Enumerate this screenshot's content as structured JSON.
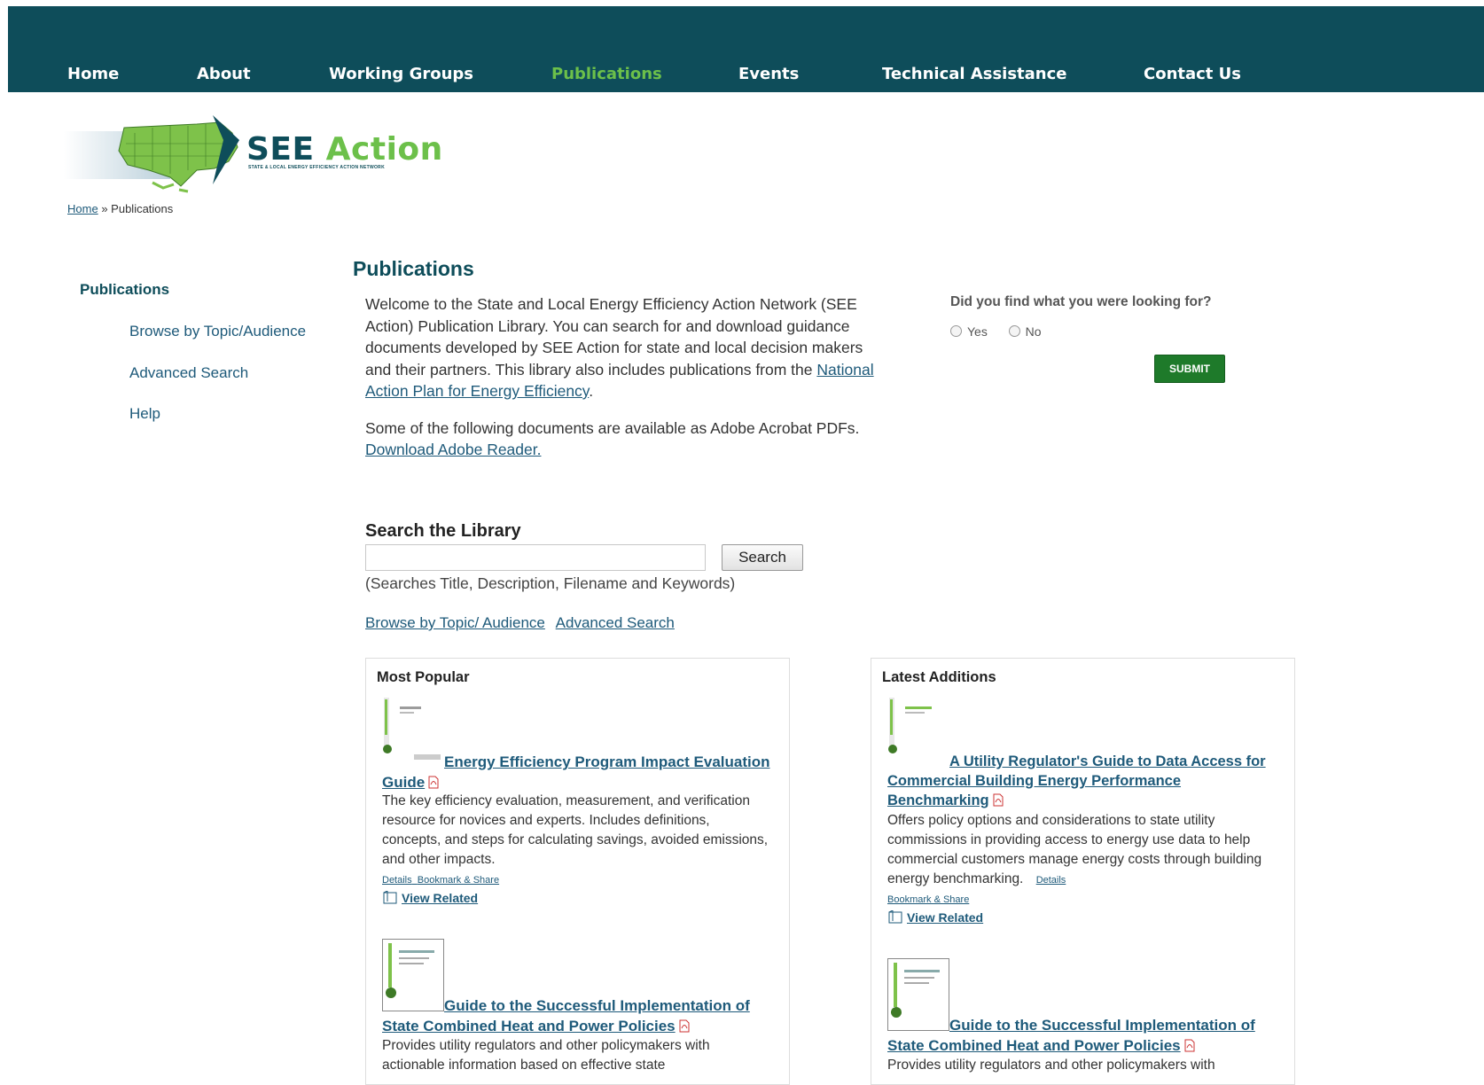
{
  "nav": {
    "items": [
      {
        "label": "Home"
      },
      {
        "label": "About"
      },
      {
        "label": "Working Groups"
      },
      {
        "label": "Publications"
      },
      {
        "label": "Events"
      },
      {
        "label": "Technical Assistance"
      },
      {
        "label": "Contact Us"
      }
    ],
    "active": "Publications",
    "colors": {
      "bar": "#0e4d5a",
      "active": "#6cc04a",
      "text": "#ffffff"
    }
  },
  "logo": {
    "see": "SEE",
    "action": "Action",
    "tagline": "STATE & LOCAL ENERGY EFFICIENCY ACTION NETWORK"
  },
  "breadcrumb": {
    "home": "Home",
    "sep": "»",
    "current": "Publications"
  },
  "sidebar": {
    "title": "Publications",
    "links": [
      {
        "label": "Browse by Topic/Audience"
      },
      {
        "label": "Advanced Search"
      },
      {
        "label": "Help"
      }
    ]
  },
  "main": {
    "title": "Publications",
    "intro_p1_before": "Welcome to the State and Local Energy Efficiency Action Network (SEE Action) Publication Library. You can search for and download guidance documents developed by SEE Action for state and local decision makers and their partners. This library also includes publications from the ",
    "intro_p1_link": "National Action Plan for Energy Efficiency",
    "intro_p1_after": ".",
    "intro_p2_before": "Some of the following documents are available as Adobe Acrobat PDFs. ",
    "intro_p2_link": "Download Adobe Reader."
  },
  "survey": {
    "question": "Did you find what you were looking for?",
    "yes": "Yes",
    "no": "No",
    "submit": "SUBMIT"
  },
  "search": {
    "heading": "Search the Library",
    "value": "",
    "button": "Search",
    "help": "(Searches Title, Description, Filename and Keywords)",
    "link_browse": "Browse by Topic/ Audience",
    "link_advanced": "Advanced Search"
  },
  "most_popular": {
    "title": "Most Popular",
    "items": [
      {
        "title": "Energy Efficiency Program Impact Evaluation Guide",
        "description": "The key efficiency evaluation, measurement, and verification resource for novices and experts. Includes definitions, concepts, and steps for calculating savings, avoided emissions, and other impacts.",
        "details": "Details",
        "bookmark": "Bookmark & Share",
        "view_related": "View Related"
      },
      {
        "title": "Guide to the Successful Implementation of State Combined Heat and Power Policies",
        "description": "Provides utility regulators and other policymakers with actionable information based on effective state"
      }
    ]
  },
  "latest_additions": {
    "title": "Latest Additions",
    "items": [
      {
        "title": "A Utility Regulator's Guide to Data Access for Commercial Building Energy Performance Benchmarking",
        "description": "Offers policy options and considerations to state utility commissions in providing access to energy use data to help commercial customers manage energy costs through building energy benchmarking.",
        "details": "Details",
        "bookmark": "Bookmark & Share",
        "view_related": "View Related"
      },
      {
        "title": "Guide to the Successful Implementation of State Combined Heat and Power Policies",
        "description": "Provides utility regulators and other policymakers with"
      }
    ]
  }
}
